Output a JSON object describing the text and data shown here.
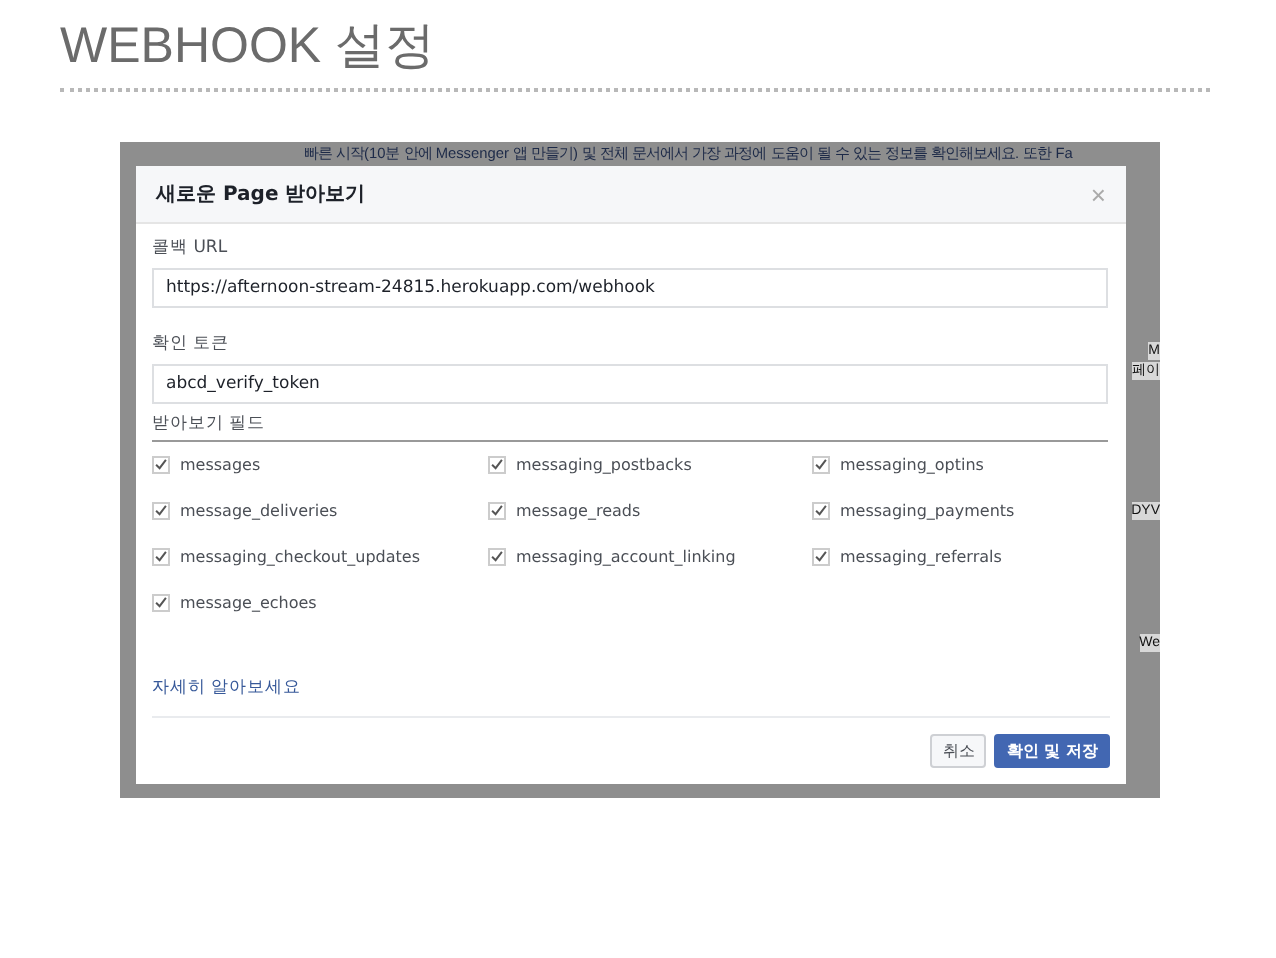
{
  "slide_title": "WEBHOOK 설정",
  "background_page": {
    "notice": "빠른 시작(10분 안에 Messenger 앱 만들기) 및 전체 문서에서 가장 과정에 도움이 될 수 있는 정보를 확인해보세요. 또한 Fa",
    "fragments": [
      "M",
      "페이",
      "DYV",
      "We"
    ]
  },
  "dialog": {
    "title": "새로운 Page 받아보기",
    "close": "×",
    "callback_url": {
      "label": "콜백 URL",
      "value": "https://afternoon-stream-24815.herokuapp.com/webhook"
    },
    "verify_token": {
      "label": "확인 토큰",
      "value": "abcd_verify_token"
    },
    "fields_label": "받아보기 필드",
    "fields": [
      {
        "label": "messages",
        "checked": true
      },
      {
        "label": "messaging_postbacks",
        "checked": true
      },
      {
        "label": "messaging_optins",
        "checked": true
      },
      {
        "label": "message_deliveries",
        "checked": true
      },
      {
        "label": "message_reads",
        "checked": true
      },
      {
        "label": "messaging_payments",
        "checked": true
      },
      {
        "label": "messaging_checkout_updates",
        "checked": true
      },
      {
        "label": "messaging_account_linking",
        "checked": true
      },
      {
        "label": "messaging_referrals",
        "checked": true
      },
      {
        "label": "message_echoes",
        "checked": true
      }
    ],
    "learn_more": "자세히 알아보세요",
    "buttons": [
      {
        "label": "취소",
        "kind": "secondary"
      },
      {
        "label": "확인 및 저장",
        "kind": "primary"
      }
    ]
  }
}
